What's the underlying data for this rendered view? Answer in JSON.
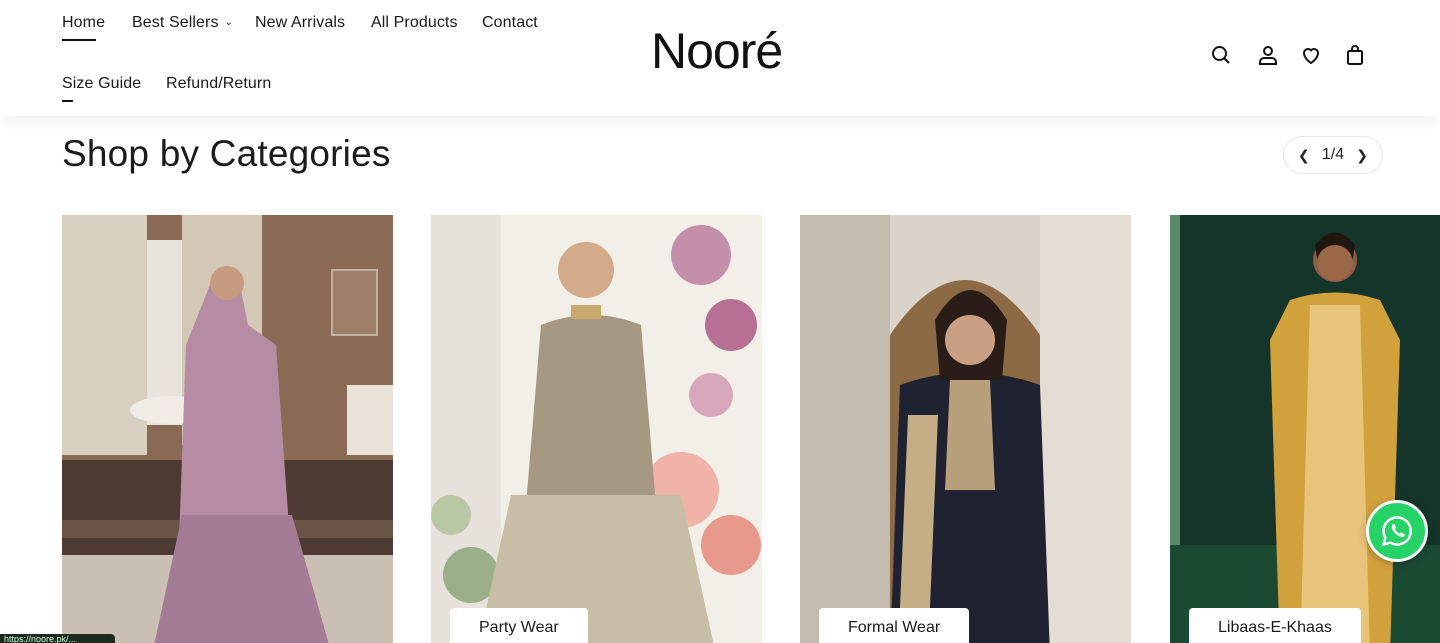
{
  "nav": {
    "home": "Home",
    "best_sellers": "Best Sellers",
    "new_arrivals": "New Arrivals",
    "all_products": "All Products",
    "contact": "Contact",
    "size_guide": "Size Guide",
    "refund": "Refund/Return"
  },
  "brand": {
    "logo": "Nooré"
  },
  "icons": [
    "search-icon",
    "account-icon",
    "wishlist-icon",
    "cart-icon"
  ],
  "section": {
    "title": "Shop by Categories"
  },
  "pager": {
    "indicator": "1/4"
  },
  "categories": [
    {
      "label": ""
    },
    {
      "label": "Party Wear"
    },
    {
      "label": "Formal Wear"
    },
    {
      "label": "Libaas-E-Khaas"
    }
  ],
  "status_bar": {
    "url": "https://noore.pk/..."
  }
}
